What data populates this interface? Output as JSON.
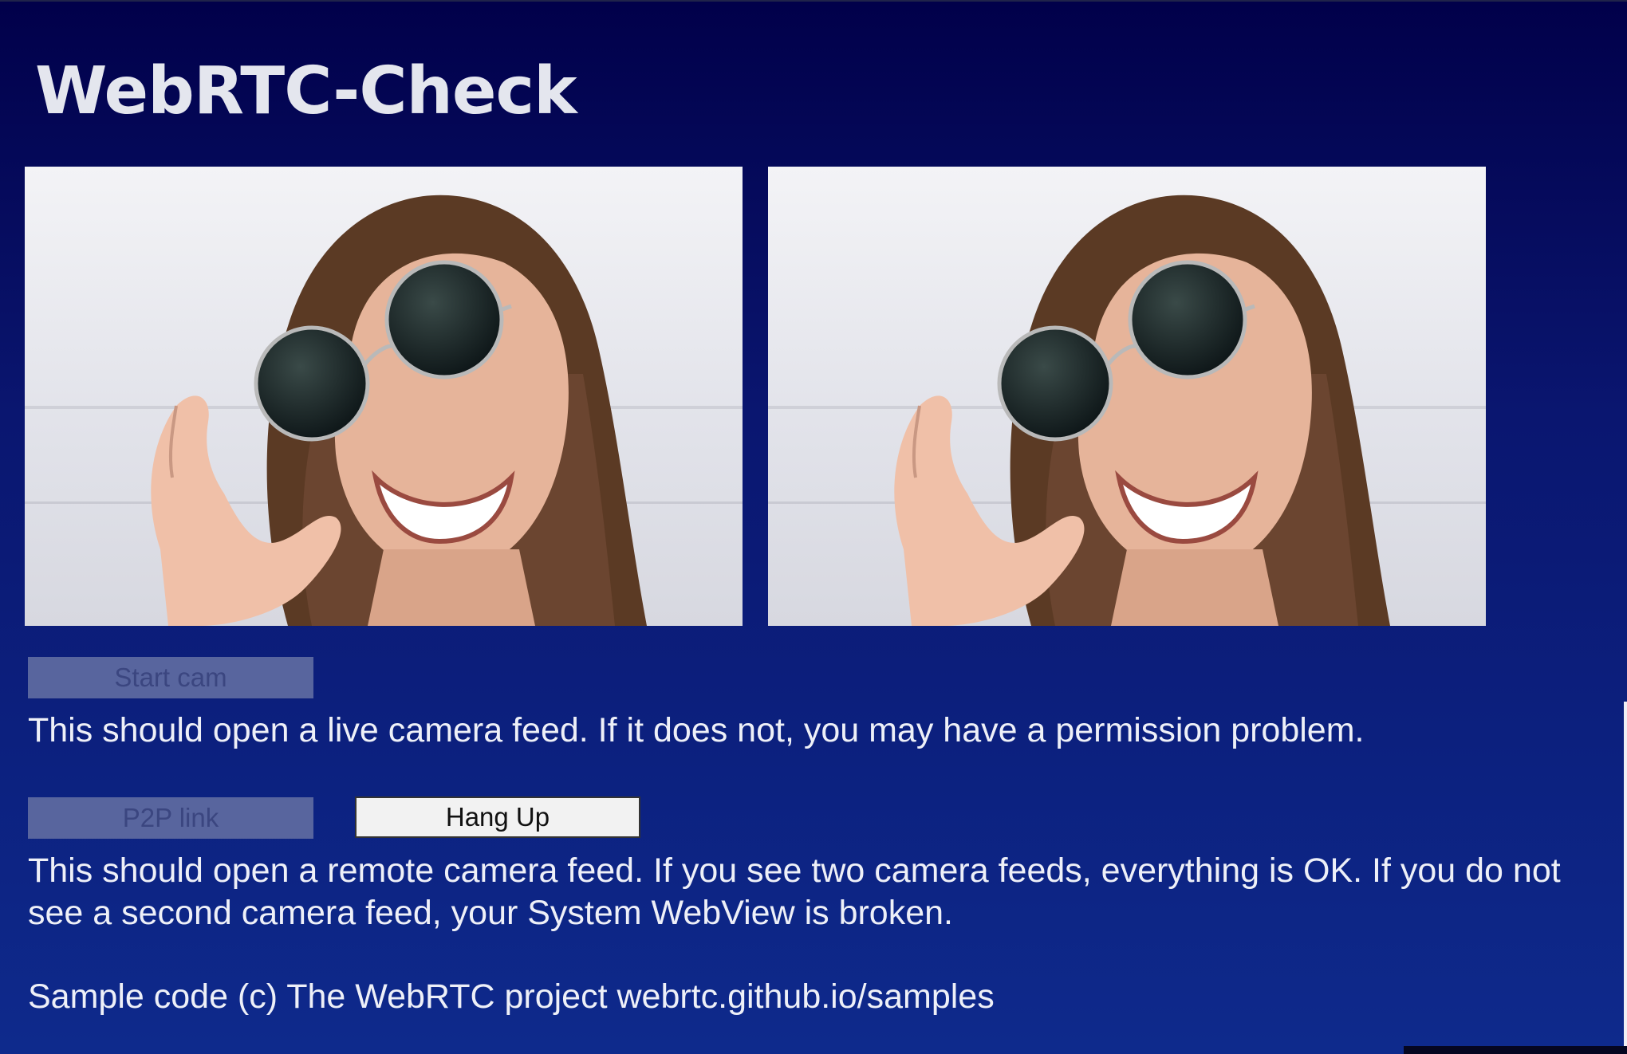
{
  "page": {
    "title": "WebRTC-Check"
  },
  "videos": {
    "local": "local-camera-feed",
    "remote": "remote-camera-feed"
  },
  "controls": {
    "start_cam_label": "Start cam",
    "p2p_link_label": "P2P link",
    "hang_up_label": "Hang Up"
  },
  "text": {
    "start_cam_description": "This should open a live camera feed. If it does not, you may have a permission problem.",
    "p2p_description": "This should open a remote camera feed. If you see two camera feeds, everything is OK. If you do not see a second camera feed, your System WebView is broken.",
    "credit": "Sample code (c) The WebRTC project webrtc.github.io/samples"
  },
  "colors": {
    "background_top": "#01004a",
    "background_bottom": "#0e2a8c",
    "disabled_button": "#58659e",
    "enabled_button": "#f2f2f2"
  },
  "states": {
    "start_cam_enabled": false,
    "p2p_link_enabled": false,
    "hang_up_enabled": true
  }
}
